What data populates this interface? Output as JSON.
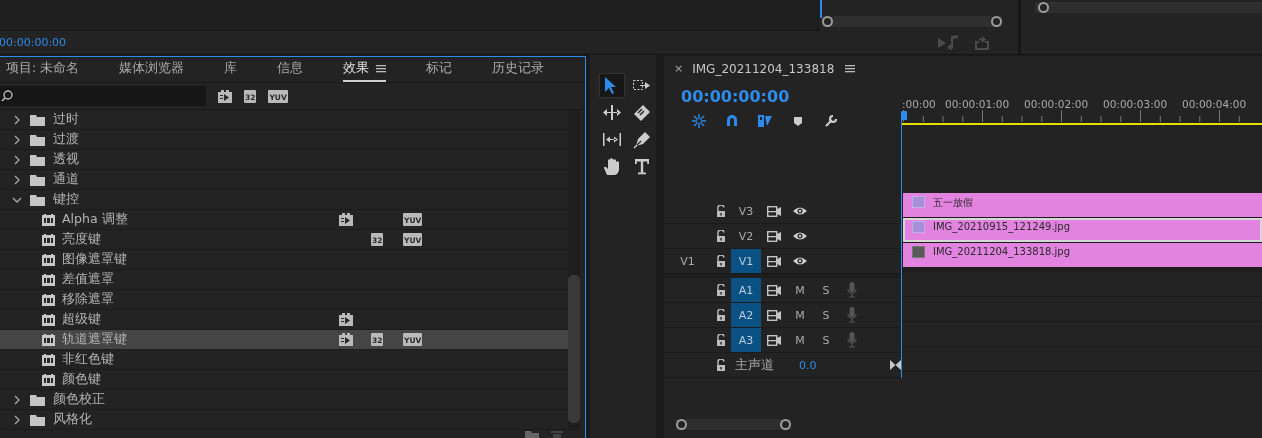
{
  "source_monitor": {
    "timecode": "00:00:00:00"
  },
  "effects_panel": {
    "tabs": [
      {
        "label": "项目: 未命名",
        "selected": false
      },
      {
        "label": "媒体浏览器",
        "selected": false
      },
      {
        "label": "库",
        "selected": false
      },
      {
        "label": "信息",
        "selected": false
      },
      {
        "label": "效果",
        "selected": true
      },
      {
        "label": "标记",
        "selected": false
      },
      {
        "label": "历史记录",
        "selected": false
      }
    ],
    "filter_buttons": [
      {
        "kind": "accelerated"
      },
      {
        "kind": "bit32",
        "label": "32"
      },
      {
        "kind": "yuv",
        "label": "YUV"
      }
    ],
    "tree": [
      {
        "label": "过时",
        "expanded": false
      },
      {
        "label": "过渡",
        "expanded": false
      },
      {
        "label": "透视",
        "expanded": false
      },
      {
        "label": "通道",
        "expanded": false
      },
      {
        "label": "键控",
        "expanded": true,
        "children": [
          {
            "label": "Alpha 调整",
            "selected": false,
            "badges": [
              {
                "kind": "accelerated"
              },
              {
                "kind": "yuv",
                "label": "YUV"
              }
            ]
          },
          {
            "label": "亮度键",
            "selected": false,
            "badges": [
              {
                "kind": "bit32",
                "label": "32"
              },
              {
                "kind": "yuv",
                "label": "YUV"
              }
            ]
          },
          {
            "label": "图像遮罩键",
            "selected": false
          },
          {
            "label": "差值遮罩",
            "selected": false
          },
          {
            "label": "移除遮罩",
            "selected": false
          },
          {
            "label": "超级键",
            "selected": false,
            "badges": [
              {
                "kind": "accelerated"
              }
            ]
          },
          {
            "label": "轨道遮罩键",
            "selected": true,
            "badges": [
              {
                "kind": "accelerated"
              },
              {
                "kind": "bit32",
                "label": "32"
              },
              {
                "kind": "yuv",
                "label": "YUV"
              }
            ]
          },
          {
            "label": "非红色键",
            "selected": false
          },
          {
            "label": "颜色键",
            "selected": false
          }
        ]
      },
      {
        "label": "颜色校正",
        "expanded": false
      },
      {
        "label": "风格化",
        "expanded": false
      }
    ]
  },
  "tools": [
    {
      "kind": "selection",
      "selected": true
    },
    {
      "kind": "track-select",
      "selected": false
    },
    {
      "kind": "ripple",
      "selected": false
    },
    {
      "kind": "razor",
      "selected": false
    },
    {
      "kind": "slip",
      "selected": false
    },
    {
      "kind": "pen",
      "selected": false
    },
    {
      "kind": "hand",
      "selected": false
    },
    {
      "kind": "type",
      "selected": false
    }
  ],
  "timeline": {
    "close": "×",
    "title": "IMG_20211204_133818",
    "timecode": "00:00:00:00",
    "ruler": [
      ":00:00",
      "00:00:01:00",
      "00:00:02:00",
      "00:00:03:00",
      "00:00:04:00"
    ],
    "video_tracks": [
      {
        "name": "V3",
        "targeted": false,
        "clip": {
          "name": "五一放假",
          "selected": false,
          "fx_applied": true
        }
      },
      {
        "name": "V2",
        "targeted": false,
        "clip": {
          "name": "IMG_20210915_121249.jpg",
          "selected": true,
          "fx_applied": true
        }
      },
      {
        "source": "V1",
        "name": "V1",
        "targeted": true,
        "clip": {
          "name": "IMG_20211204_133818.jpg",
          "selected": false,
          "fx_applied": false
        }
      }
    ],
    "audio_tracks": [
      {
        "name": "A1",
        "targeted": true,
        "mute": "M",
        "solo": "S"
      },
      {
        "name": "A2",
        "targeted": true,
        "mute": "M",
        "solo": "S"
      },
      {
        "name": "A3",
        "targeted": true,
        "mute": "M",
        "solo": "S"
      }
    ],
    "master": {
      "name": "主声道",
      "volume": "0.0"
    }
  }
}
